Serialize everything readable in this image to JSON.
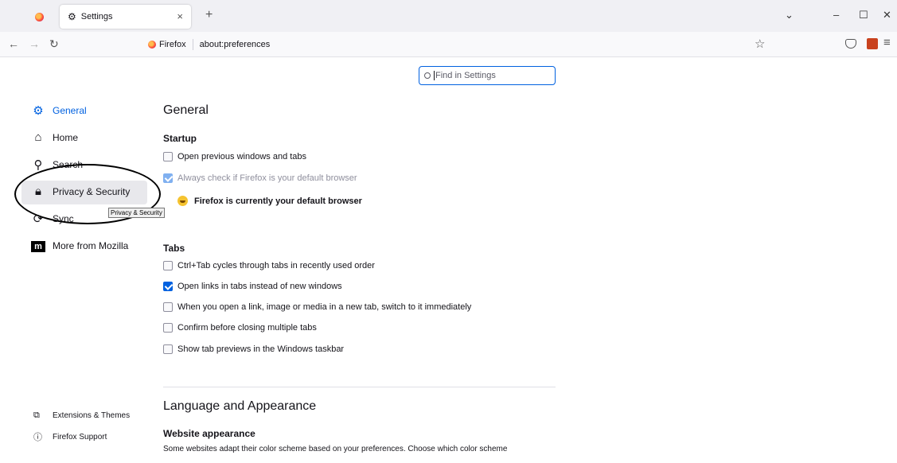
{
  "browser": {
    "tab_title": "Settings",
    "identity_label": "Firefox",
    "url": "about:preferences"
  },
  "search": {
    "placeholder": "Find in Settings"
  },
  "sidebar": {
    "items": [
      {
        "label": "General",
        "icon": "gear-icon",
        "selected": true
      },
      {
        "label": "Home",
        "icon": "home-icon"
      },
      {
        "label": "Search",
        "icon": "search-icon"
      },
      {
        "label": "Privacy & Security",
        "icon": "lock-icon"
      },
      {
        "label": "Sync",
        "icon": "sync-icon"
      },
      {
        "label": "More from Mozilla",
        "icon": "mozilla-logo"
      }
    ],
    "tooltip": "Privacy & Security",
    "footer": [
      {
        "label": "Extensions & Themes",
        "icon": "puzzle-icon"
      },
      {
        "label": "Firefox Support",
        "icon": "help-icon"
      }
    ]
  },
  "main": {
    "title": "General",
    "startup": {
      "heading": "Startup",
      "open_previous": "Open previous windows and tabs",
      "check_default": "Always check if Firefox is your default browser",
      "default_msg": "Firefox is currently your default browser"
    },
    "tabs": {
      "heading": "Tabs",
      "items": [
        {
          "label": "Ctrl+Tab cycles through tabs in recently used order",
          "checked": false
        },
        {
          "label": "Open links in tabs instead of new windows",
          "checked": true
        },
        {
          "label": "When you open a link, image or media in a new tab, switch to it immediately",
          "checked": false
        },
        {
          "label": "Confirm before closing multiple tabs",
          "checked": false
        },
        {
          "label": "Show tab previews in the Windows taskbar",
          "checked": false
        }
      ]
    },
    "language": {
      "heading": "Language and Appearance",
      "website_appearance": "Website appearance",
      "description": "Some websites adapt their color scheme based on your preferences. Choose which color scheme"
    }
  },
  "colors": {
    "accent": "#0061e0",
    "highlight": "#e8e8ec"
  }
}
